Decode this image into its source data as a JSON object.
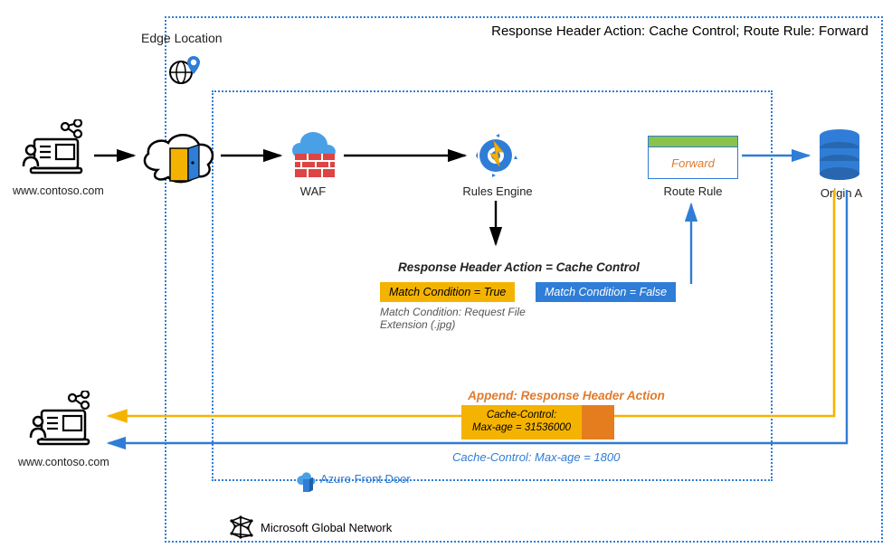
{
  "diagram": {
    "top_title": "Response Header Action: Cache Control; Route Rule: Forward",
    "edge_location": "Edge Location",
    "user_domain_top": "www.contoso.com",
    "user_domain_bottom": "www.contoso.com",
    "waf_label": "WAF",
    "rules_engine_label": "Rules Engine",
    "route_rule": {
      "label": "Route Rule",
      "action": "Forward"
    },
    "origin_label": "Origin A",
    "response_header_action_title": "Response Header Action = Cache Control",
    "match_true": "Match Condition = True",
    "match_false": "Match Condition = False",
    "match_condition_note": "Match Condition: Request File Extension (.jpg)",
    "append_title": "Append: Response Header Action",
    "cache_box_line1": "Cache-Control:",
    "cache_box_line2": "Max-age = 31536000",
    "blue_cache_note": "Cache-Control: Max-age = 1800",
    "afd_label": "Azure Front Door",
    "mgn_label": "Microsoft Global Network"
  }
}
